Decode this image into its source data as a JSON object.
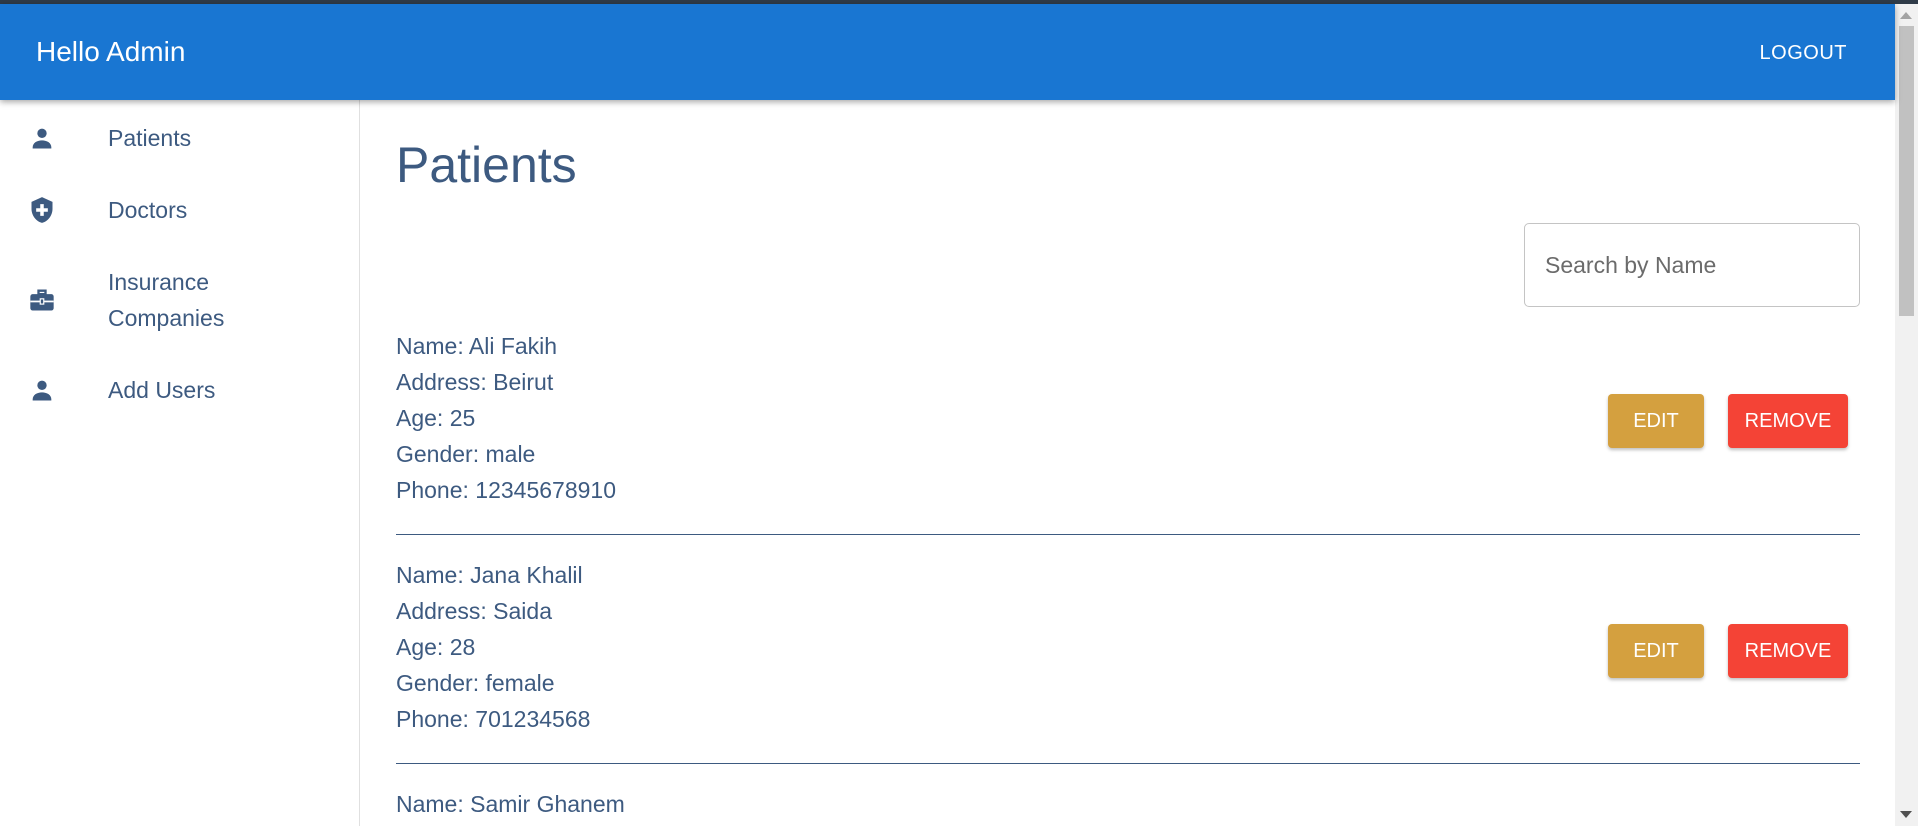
{
  "appbar": {
    "title": "Hello Admin",
    "logout_label": "LOGOUT"
  },
  "sidebar": {
    "items": [
      {
        "label": "Patients",
        "icon": "person-icon"
      },
      {
        "label": "Doctors",
        "icon": "shield-plus-icon"
      },
      {
        "label": "Insurance Companies",
        "icon": "briefcase-icon"
      },
      {
        "label": "Add Users",
        "icon": "person-icon"
      }
    ]
  },
  "main": {
    "title": "Patients",
    "search": {
      "placeholder": "Search by Name",
      "value": ""
    },
    "edit_label": "EDIT",
    "remove_label": "REMOVE",
    "patients": [
      {
        "name": "Name: Ali Fakih",
        "address": "Address: Beirut",
        "age": "Age: 25",
        "gender": "Gender: male",
        "phone": "Phone: 12345678910"
      },
      {
        "name": "Name: Jana Khalil",
        "address": "Address: Saida",
        "age": "Age: 28",
        "gender": "Gender: female",
        "phone": "Phone: 701234568"
      },
      {
        "name": "Name: Samir Ghanem"
      }
    ]
  },
  "colors": {
    "appbar": "#1976d2",
    "text": "#3d5a80",
    "edit_button": "#d4a03f",
    "remove_button": "#f44336"
  }
}
